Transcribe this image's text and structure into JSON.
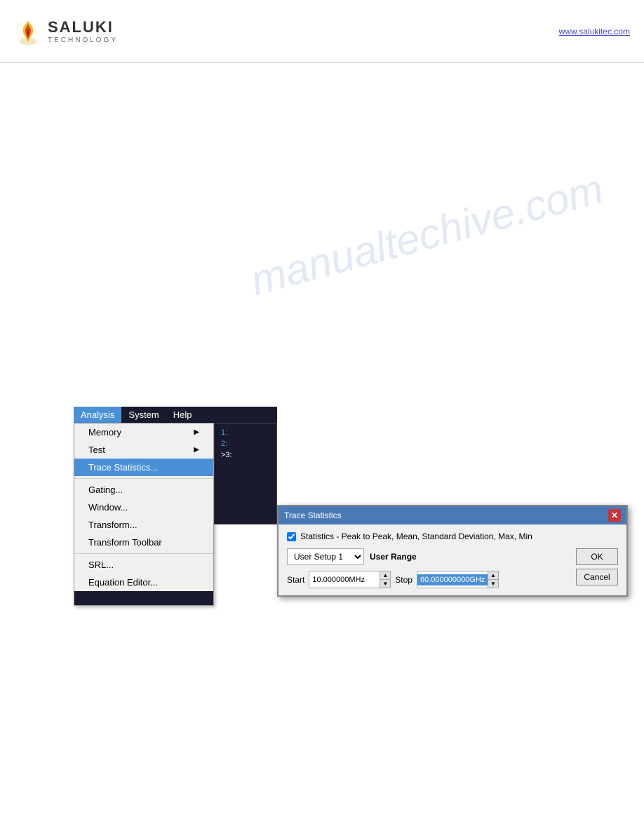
{
  "header": {
    "logo_saluki": "SALUKI",
    "logo_technology": "TECHNOLOGY",
    "link_text": "www.salukitec.com"
  },
  "watermark": {
    "text": "manualtechive.com"
  },
  "menu": {
    "items": [
      {
        "label": "Analysis",
        "active": true
      },
      {
        "label": "System",
        "active": false
      },
      {
        "label": "Help",
        "active": false
      }
    ]
  },
  "dropdown": {
    "items": [
      {
        "label": "Memory",
        "has_arrow": true,
        "separator_after": false
      },
      {
        "label": "Test",
        "has_arrow": true,
        "separator_after": false
      },
      {
        "label": "Trace Statistics...",
        "has_arrow": false,
        "highlighted": true,
        "separator_after": true
      },
      {
        "label": "Gating...",
        "has_arrow": false,
        "separator_after": false
      },
      {
        "label": "Window...",
        "has_arrow": false,
        "separator_after": false
      },
      {
        "label": "Transform...",
        "has_arrow": false,
        "separator_after": false
      },
      {
        "label": "Transform Toolbar",
        "has_arrow": false,
        "separator_after": true
      },
      {
        "label": "SRL...",
        "has_arrow": false,
        "separator_after": false
      },
      {
        "label": "Equation Editor...",
        "has_arrow": false,
        "separator_after": false
      }
    ]
  },
  "trace_panel": {
    "lines": [
      {
        "label": "1:",
        "active": false
      },
      {
        "label": "2:",
        "active": false
      },
      {
        "label": ">3:",
        "active": true
      }
    ]
  },
  "dialog": {
    "title": "Trace Statistics",
    "close_label": "✕",
    "checkbox_label": "Statistics - Peak to Peak, Mean, Standard Deviation, Max, Min",
    "select_label": "User Setup 1",
    "user_range_label": "User Range",
    "start_label": "Start",
    "start_value": "10.000000MHz",
    "stop_label": "Stop",
    "stop_value": "60.000000000GHz",
    "ok_label": "OK",
    "cancel_label": "Cancel"
  }
}
